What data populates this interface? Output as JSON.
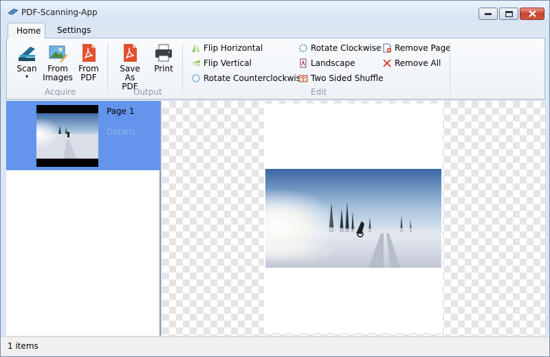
{
  "window": {
    "title": "PDF-Scanning-App"
  },
  "tabs": [
    {
      "label": "Home"
    },
    {
      "label": "Settings"
    }
  ],
  "ribbon": {
    "acquire": {
      "group_label": "Acquire",
      "scan_label": "Scan",
      "from_images_label": "From\nImages",
      "from_pdf_label": "From\nPDF"
    },
    "output": {
      "group_label": "Output",
      "save_as_pdf_label": "Save As\nPDF",
      "print_label": "Print"
    },
    "edit": {
      "group_label": "Edit",
      "flip_horizontal": "Flip Horizontal",
      "flip_vertical": "Flip Vertical",
      "rotate_counterclockwise": "Rotate Counterclockwise",
      "rotate_clockwise": "Rotate Clockwise",
      "landscape": "Landscape",
      "two_sided_shuffle": "Two Sided Shuffle",
      "remove_page": "Remove Page",
      "remove_all": "Remove All"
    }
  },
  "pages_list": {
    "items": [
      {
        "label": "Page 1",
        "details": "Details"
      }
    ]
  },
  "status": {
    "items_count": "1 items"
  },
  "colors": {
    "selection": "#6495ed",
    "accent_red": "#d9361f",
    "ribbon_border": "#a9b8cc"
  },
  "icons": [
    "scanner-icon",
    "image-icon",
    "pdf-icon",
    "printer-icon",
    "flip-horizontal-icon",
    "flip-vertical-icon",
    "rotate-ccw-icon",
    "rotate-cw-icon",
    "landscape-icon",
    "shuffle-icon",
    "remove-page-icon",
    "remove-all-icon"
  ]
}
